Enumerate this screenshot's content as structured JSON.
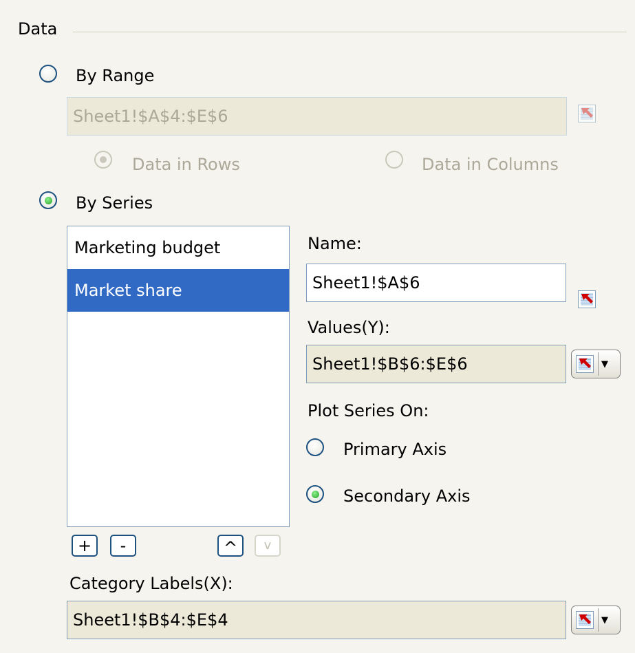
{
  "group": {
    "title": "Data"
  },
  "by_range": {
    "label": "By Range",
    "value": "Sheet1!$A$4:$E$6",
    "rows_label": "Data in Rows",
    "columns_label": "Data in Columns"
  },
  "by_series": {
    "label": "By Series",
    "series": [
      {
        "label": "Marketing budget",
        "selected": false
      },
      {
        "label": "Market share",
        "selected": true
      }
    ],
    "buttons": {
      "add": "+",
      "remove": "-",
      "up": "^",
      "down": "v"
    }
  },
  "series_props": {
    "name_label": "Name:",
    "name_value": "Sheet1!$A$6",
    "values_label": "Values(Y):",
    "values_value": "Sheet1!$B$6:$E$6",
    "plot_on_label": "Plot Series On:",
    "primary_label": "Primary Axis",
    "secondary_label": "Secondary Axis",
    "plot_on_selected": "Secondary Axis"
  },
  "category": {
    "label": "Category Labels(X):",
    "value": "Sheet1!$B$4:$E$4"
  },
  "icons": {
    "range_picker": "range-select-icon",
    "dropdown": "dropdown-arrow-icon"
  },
  "colors": {
    "selection": "#316ac5",
    "radio_border": "#1c5180",
    "radio_dot": "#21a121",
    "panel_bg": "#f5f4ef",
    "field_bg": "#ece9d8"
  }
}
